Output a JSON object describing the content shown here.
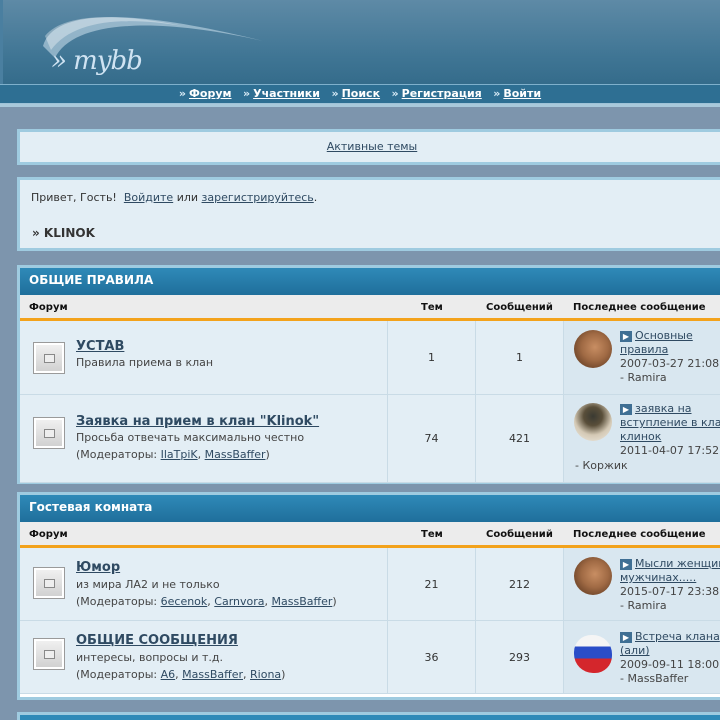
{
  "header": {
    "logo": "» mybb"
  },
  "nav": {
    "items": [
      {
        "label": "Форум"
      },
      {
        "label": "Участники"
      },
      {
        "label": "Поиск"
      },
      {
        "label": "Регистрация"
      },
      {
        "label": "Войти"
      }
    ]
  },
  "active_topics": "Активные темы",
  "welcome": {
    "greet_prefix": "Привет, Гость!",
    "login": "Войдите",
    "or": "или",
    "register": "зарегистрируйтесь",
    "dot": ".",
    "breadcrumb": "» KLINOK"
  },
  "columns": {
    "forum": "Форум",
    "topics": "Тем",
    "posts": "Сообщений",
    "last": "Последнее сообщение"
  },
  "categories": [
    {
      "title": "ОБЩИЕ ПРАВИЛА",
      "forums": [
        {
          "title": "УСТАВ",
          "desc": "Правила приема в клан",
          "topics": "1",
          "posts": "1",
          "last_title": "Основные правила",
          "last_date": "2007-03-27 21:08",
          "last_by": "- Ramira"
        },
        {
          "title": "Заявка на прием в клан \"Klinok\"",
          "desc": "Просьба отвечать максимально честно",
          "mods_prefix": "(Модераторы:",
          "mods": [
            "IlaTpiK",
            "MassBaffer"
          ],
          "mods_suffix": ")",
          "topics": "74",
          "posts": "421",
          "last_title": "заявка на вступление в клан клинок",
          "last_date": "2011-04-07 17:52",
          "last_by": "- Коржик"
        }
      ]
    },
    {
      "title": "Гостевая комната",
      "forums": [
        {
          "title": "Юмор",
          "desc": "из мира ЛА2 и не только",
          "mods_prefix": "(Модераторы:",
          "mods": [
            "6ecenok",
            "Carnvora",
            "MassBaffer"
          ],
          "mods_suffix": ")",
          "topics": "21",
          "posts": "212",
          "last_title": "Мысли женщин о мужчинах.....",
          "last_date": "2015-07-17 23:38",
          "last_by": "- Ramira"
        },
        {
          "title": "ОБЩИЕ СООБЩЕНИЯ",
          "desc": "интересы, вопросы и т.д.",
          "mods_prefix": "(Модераторы:",
          "mods": [
            "A6",
            "MassBaffer",
            "Riona"
          ],
          "mods_suffix": ")",
          "topics": "36",
          "posts": "293",
          "last_title": "Встреча клана (али)",
          "last_date": "2009-09-11 18:00",
          "last_by": "- MassBaffer"
        }
      ]
    }
  ]
}
